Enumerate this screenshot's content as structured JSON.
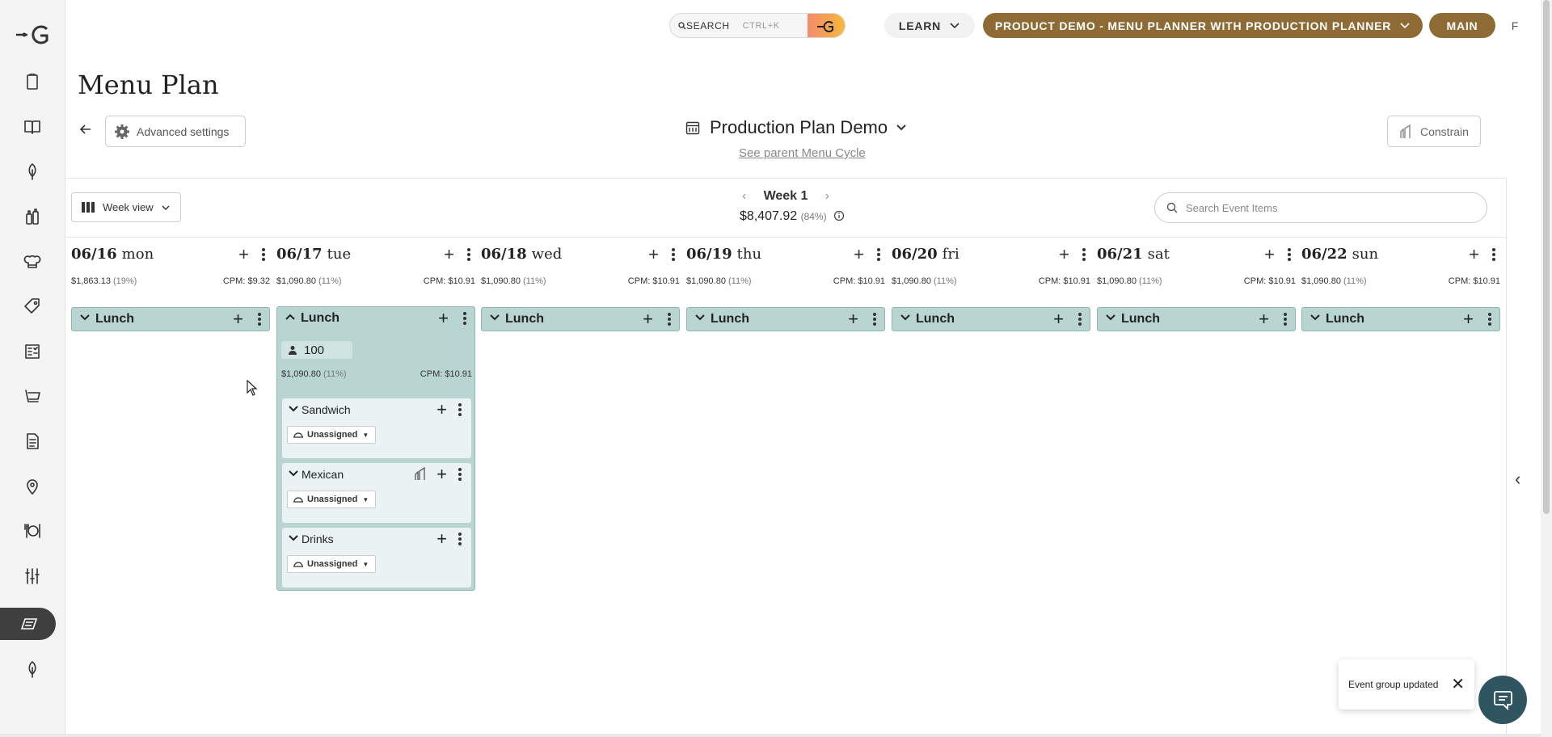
{
  "topbar": {
    "search_label": "SEARCH",
    "search_shortcut": "CTRL+K",
    "learn_label": "LEARN",
    "project_label": "PRODUCT DEMO - MENU PLANNER WITH PRODUCTION PLANNER",
    "branch_label": "MAIN",
    "user_initial": "F"
  },
  "sidebar": {
    "items": [
      "clipboard-icon",
      "book-icon",
      "leaf-icon",
      "bottles-icon",
      "chef-hat-icon",
      "tag-icon",
      "checklist-icon",
      "cart-icon",
      "document-icon",
      "location-pin-icon",
      "plate-fork-icon",
      "sliders-icon",
      "menu-plan-icon",
      "leaf-icon"
    ],
    "active_index": 12
  },
  "page": {
    "title": "Menu Plan",
    "advanced_settings": "Advanced settings",
    "plan_name": "Production Plan Demo",
    "parent_link": "See parent Menu Cycle",
    "constrain": "Constrain"
  },
  "toolbar": {
    "view_label": "Week view",
    "week_label": "Week 1",
    "week_cost": "$8,407.92",
    "week_pct": "(84%)",
    "search_placeholder": "Search Event Items"
  },
  "days": [
    {
      "date": "06/16",
      "name": "mon",
      "cost": "$1,863.13",
      "pct": "(19%)",
      "cpm": "CPM:  $9.32",
      "meal": "Lunch"
    },
    {
      "date": "06/17",
      "name": "tue",
      "cost": "$1,090.80",
      "pct": "(11%)",
      "cpm": "CPM:  $10.91",
      "meal": "Lunch"
    },
    {
      "date": "06/18",
      "name": "wed",
      "cost": "$1,090.80",
      "pct": "(11%)",
      "cpm": "CPM:  $10.91",
      "meal": "Lunch"
    },
    {
      "date": "06/19",
      "name": "thu",
      "cost": "$1,090.80",
      "pct": "(11%)",
      "cpm": "CPM:  $10.91",
      "meal": "Lunch"
    },
    {
      "date": "06/20",
      "name": "fri",
      "cost": "$1,090.80",
      "pct": "(11%)",
      "cpm": "CPM:  $10.91",
      "meal": "Lunch"
    },
    {
      "date": "06/21",
      "name": "sat",
      "cost": "$1,090.80",
      "pct": "(11%)",
      "cpm": "CPM:  $10.91",
      "meal": "Lunch"
    },
    {
      "date": "06/22",
      "name": "sun",
      "cost": "$1,090.80",
      "pct": "(11%)",
      "cpm": "CPM:  $10.91",
      "meal": "Lunch"
    }
  ],
  "expanded_meal": {
    "label": "Lunch",
    "guests": "100",
    "cost": "$1,090.80",
    "pct": "(11%)",
    "cpm": "CPM:  $10.91",
    "courses": [
      {
        "name": "Sandwich",
        "station": "Unassigned"
      },
      {
        "name": "Mexican",
        "station": "Unassigned"
      },
      {
        "name": "Drinks",
        "station": "Unassigned"
      }
    ]
  },
  "toast": {
    "message": "Event group updated"
  },
  "colors": {
    "brand": "#8e6b34",
    "meal": "#b9d5d1",
    "course": "#eaf2f4",
    "chat": "#2e5560"
  }
}
